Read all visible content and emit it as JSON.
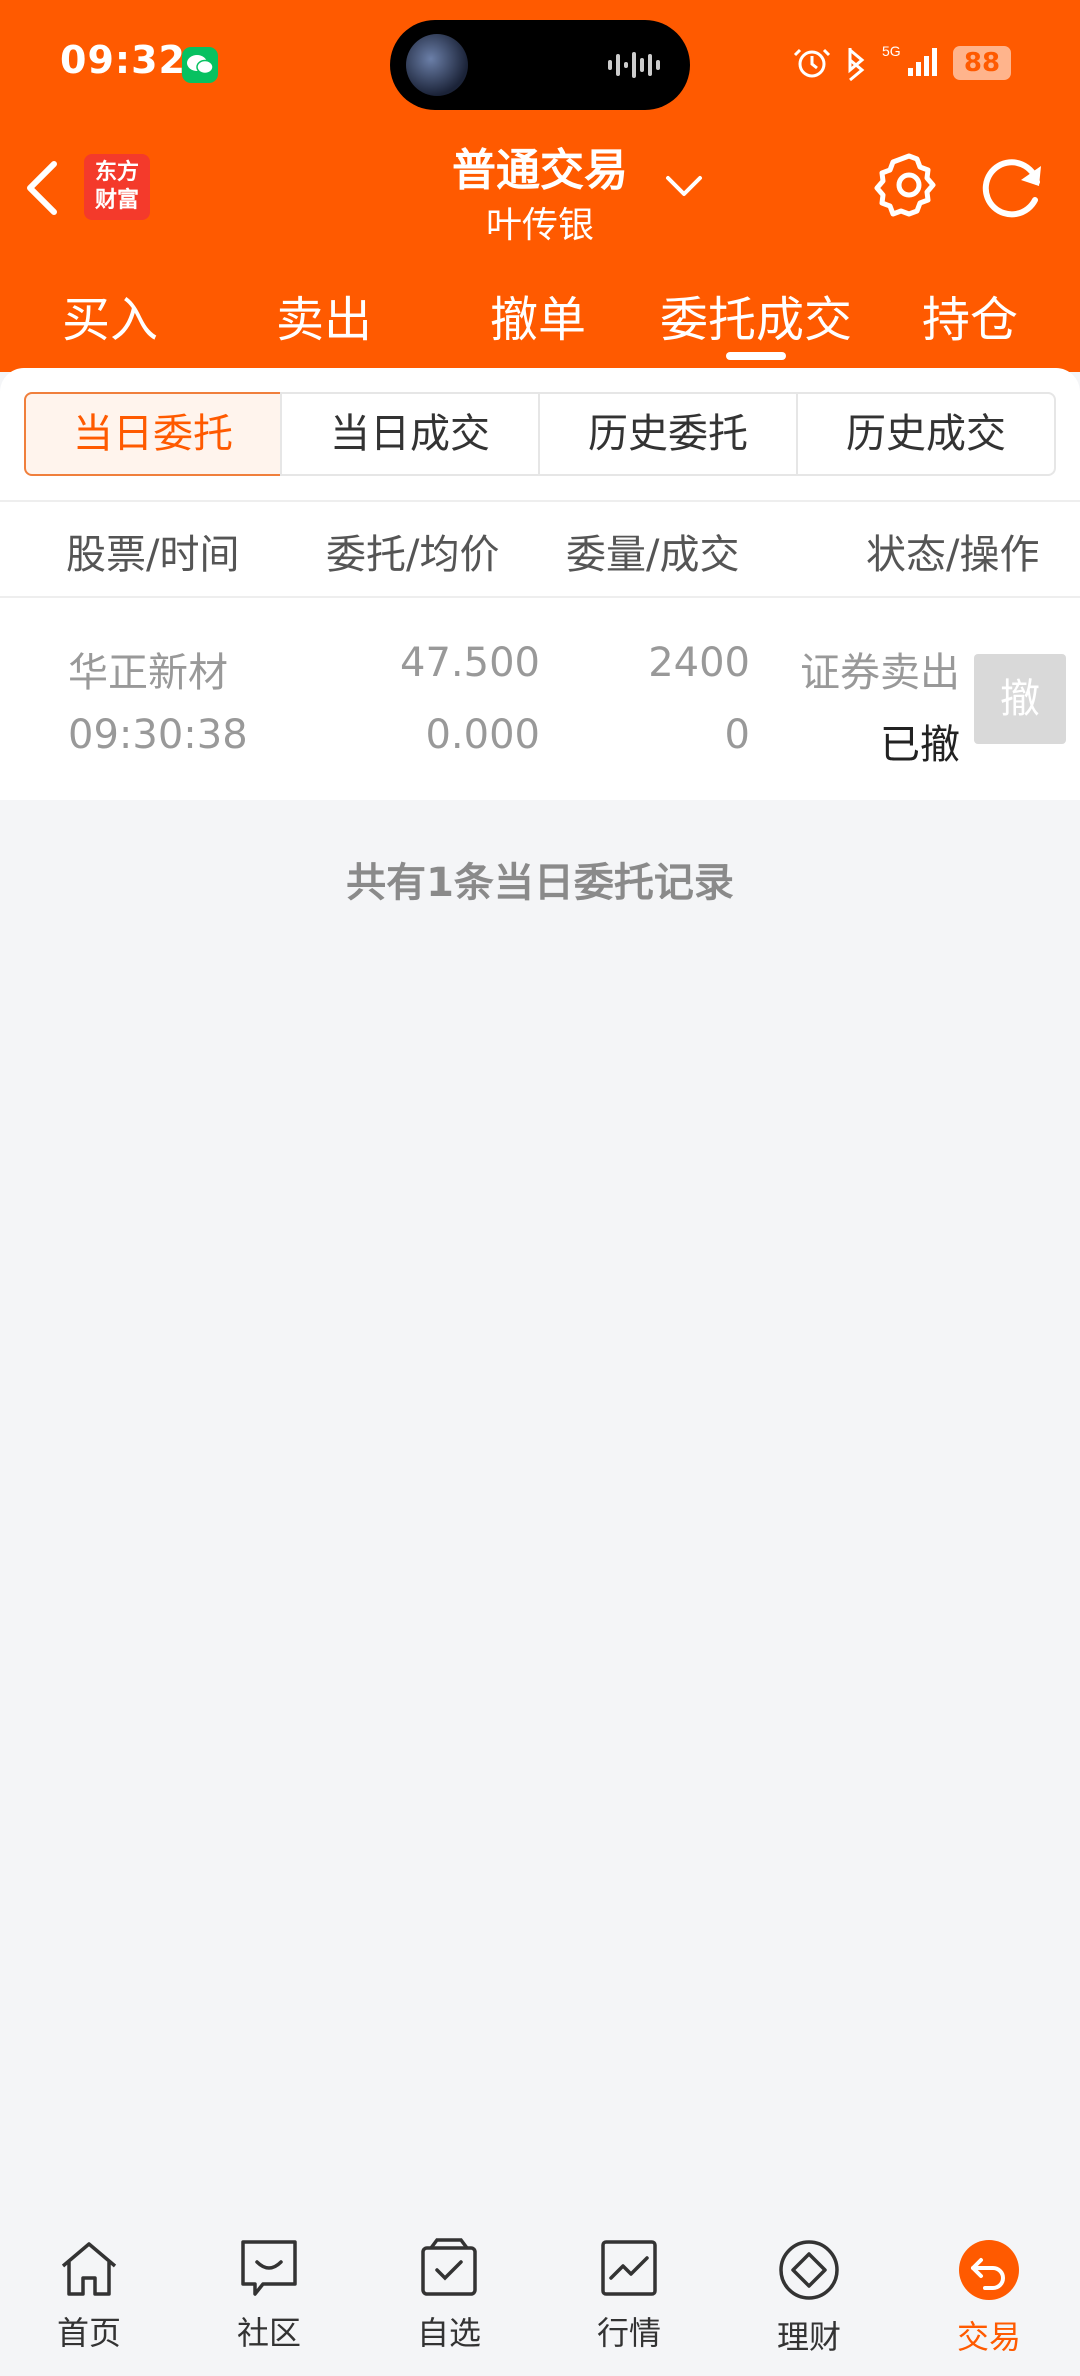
{
  "status_bar": {
    "time": "09:32",
    "battery": "88",
    "network": "5G"
  },
  "header": {
    "logo_line1": "东方",
    "logo_line2": "财富",
    "title": "普通交易",
    "subtitle": "叶传银"
  },
  "main_tabs": [
    {
      "label": "买入"
    },
    {
      "label": "卖出"
    },
    {
      "label": "撤单"
    },
    {
      "label": "委托成交",
      "active": true
    },
    {
      "label": "持仓"
    }
  ],
  "sub_tabs": [
    {
      "label": "当日委托",
      "active": true
    },
    {
      "label": "当日成交"
    },
    {
      "label": "历史委托"
    },
    {
      "label": "历史成交"
    }
  ],
  "table": {
    "headers": [
      "股票/时间",
      "委托/均价",
      "委量/成交",
      "状态/操作"
    ],
    "rows": [
      {
        "stock": "华正新材",
        "time": "09:30:38",
        "order_price": "47.500",
        "avg_price": "0.000",
        "order_qty": "2400",
        "filled_qty": "0",
        "direction": "证券卖出",
        "status": "已撤",
        "action_label": "撤"
      }
    ]
  },
  "record_count_text": "共有1条当日委托记录",
  "bottom_nav": [
    {
      "label": "首页",
      "icon": "home-icon"
    },
    {
      "label": "社区",
      "icon": "community-icon"
    },
    {
      "label": "自选",
      "icon": "watchlist-icon"
    },
    {
      "label": "行情",
      "icon": "market-chart-icon"
    },
    {
      "label": "理财",
      "icon": "wealth-diamond-icon"
    },
    {
      "label": "交易",
      "icon": "trade-icon",
      "active": true
    }
  ],
  "colors": {
    "brand": "#ff5a00",
    "logo_red": "#f43a2b",
    "background": "#f4f5f7"
  }
}
